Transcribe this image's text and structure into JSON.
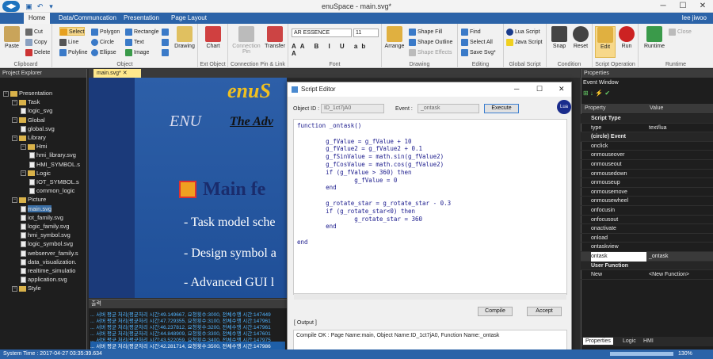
{
  "app": {
    "title": "enuSpace - main.svg*",
    "user": "lee jiwoo"
  },
  "menu_tabs": [
    "Home",
    "Data/Communcation",
    "Presentation",
    "Page Layout"
  ],
  "ribbon": {
    "clipboard": {
      "label": "Clipboard",
      "paste": "Paste",
      "cut": "Cut",
      "copy": "Copy",
      "delete": "Delete"
    },
    "object": {
      "label": "Object",
      "select": "Select",
      "line": "Line",
      "polyline": "Polyline",
      "polygon": "Polygon",
      "circle": "Circle",
      "ellipse": "Ellipse",
      "rectangle": "Rectangle",
      "text": "Text",
      "image": "Image",
      "drawing": "Drawing"
    },
    "ext_object": {
      "label": "Ext Object",
      "chart": "Chart"
    },
    "connection": {
      "label": "Connection Pin & Link",
      "pin": "Connection Pin",
      "transfer": "Transfer"
    },
    "font": {
      "label": "Font",
      "family": "AR ESSENCE",
      "size": "11"
    },
    "drawing": {
      "label": "Drawing",
      "arrange": "Arrange",
      "shape_fill": "Shape Fill",
      "shape_outline": "Shape Outline",
      "shape_effects": "Shape Effects"
    },
    "editing": {
      "label": "Editing",
      "find": "Find",
      "select_all": "Select All",
      "save_svg": "Save Svg*"
    },
    "global_script": {
      "label": "Global Script",
      "lua": "Lua Script",
      "java": "Java Script"
    },
    "condition": {
      "label": "Condition",
      "snap": "Snap",
      "reset": "Reset"
    },
    "script_op": {
      "label": "Script Operation",
      "edit": "Edit",
      "run": "Run"
    },
    "runtime": {
      "label": "Runtime",
      "runtime": "Runtime",
      "close": "Close"
    }
  },
  "project_explorer": {
    "title": "Project Explorer",
    "tree": [
      {
        "label": "Presentation",
        "level": 0,
        "type": "root"
      },
      {
        "label": "Task",
        "level": 1,
        "type": "folder"
      },
      {
        "label": "logic_svg",
        "level": 2,
        "type": "file"
      },
      {
        "label": "Global",
        "level": 1,
        "type": "folder"
      },
      {
        "label": "global.svg",
        "level": 2,
        "type": "file"
      },
      {
        "label": "Library",
        "level": 1,
        "type": "folder"
      },
      {
        "label": "Hmi",
        "level": 2,
        "type": "folder"
      },
      {
        "label": "hmi_library.svg",
        "level": 3,
        "type": "file"
      },
      {
        "label": "HMI_SYMBOL.s",
        "level": 3,
        "type": "file"
      },
      {
        "label": "Logic",
        "level": 2,
        "type": "folder"
      },
      {
        "label": "IOT_SYMBOL.s",
        "level": 3,
        "type": "file"
      },
      {
        "label": "common_logic",
        "level": 3,
        "type": "file"
      },
      {
        "label": "Picture",
        "level": 1,
        "type": "folder"
      },
      {
        "label": "main.svg",
        "level": 2,
        "type": "file",
        "selected": true
      },
      {
        "label": "iot_family.svg",
        "level": 2,
        "type": "file"
      },
      {
        "label": "logic_family.svg",
        "level": 2,
        "type": "file"
      },
      {
        "label": "hmi_symbol.svg",
        "level": 2,
        "type": "file"
      },
      {
        "label": "logic_symbol.svg",
        "level": 2,
        "type": "file"
      },
      {
        "label": "webserver_family.s",
        "level": 2,
        "type": "file"
      },
      {
        "label": "data_visualization.",
        "level": 2,
        "type": "file"
      },
      {
        "label": "realtime_simulatio",
        "level": 2,
        "type": "file"
      },
      {
        "label": "application.svg",
        "level": 2,
        "type": "file"
      },
      {
        "label": "Style",
        "level": 1,
        "type": "folder"
      }
    ]
  },
  "document": {
    "tab": "main.svg*",
    "logo": "enuS",
    "line1": "ENU",
    "line1b": "The Adv",
    "heading": "Main fe",
    "bullets": [
      "- Task model sche",
      "- Design symbol a",
      "- Advanced GUI l"
    ]
  },
  "output": {
    "title": "출력",
    "lines": [
      "... 서버 평균 처리(평균처리 시간:49.149667, 요청횟수:3000, 전체수행 시간:147449",
      "... 서버 평균 처리(평균처리 시간:47.729355, 요청횟수:3100, 전체수행 시간:147961",
      "... 서버 평균 처리(평균처리 시간:46.237812, 요청횟수:3200, 전체수행 시간:147961",
      "... 서버 평균 처리(평균처리 시간:44.848909, 요청횟수:3300, 전체수행 시간:147601",
      "... 서버 평균 처리(평균처리 시간:43.522059, 요청횟수:3400, 전체수행 시간:147975",
      "... 서버 평균 처리(평균처리 시간:42.281714, 요청횟수:3500, 전체수행 시간:147986"
    ]
  },
  "script_editor": {
    "title": "Script Editor",
    "object_id_label": "Object ID :",
    "object_id": "ID_1ct7jA0",
    "event_label": "Event :",
    "event": "_ontask",
    "execute": "Execute",
    "code": [
      "function _ontask()",
      "",
      "        g_fValue = g_fValue + 10",
      "        g_fValue2 = g_fValue2 + 0.1",
      "        g_fSinValue = math.sin(g_fValue2)",
      "        g_fCosValue = math.cos(g_fValue2)",
      "        if (g_fValue > 360) then",
      "                g_fValue = 0",
      "        end",
      "",
      "        g_rotate_star = g_rotate_star - 0.3",
      "        if (g_rotate_star<0) then",
      "                g_rotate_star = 360",
      "        end",
      "",
      "end"
    ],
    "compile": "Compile",
    "accept": "Accept",
    "output_label": "[ Output ]",
    "output_text": "Compile OK : Page Name:main, Object Name:ID_1ct7jA0, Function Name:_ontask"
  },
  "properties": {
    "title": "Properties",
    "window": "Event Window",
    "col_property": "Property",
    "col_value": "Value",
    "rows": [
      {
        "k": "Script Type",
        "v": "",
        "cat": true
      },
      {
        "k": "type",
        "v": "text/lua"
      },
      {
        "k": "(circle) Event",
        "v": "",
        "cat": true
      },
      {
        "k": "onclick",
        "v": ""
      },
      {
        "k": "onmouseover",
        "v": ""
      },
      {
        "k": "onmouseout",
        "v": ""
      },
      {
        "k": "onmousedown",
        "v": ""
      },
      {
        "k": "onmouseup",
        "v": ""
      },
      {
        "k": "onmousemove",
        "v": ""
      },
      {
        "k": "onmousewheel",
        "v": ""
      },
      {
        "k": "onfocusin",
        "v": ""
      },
      {
        "k": "onfocusout",
        "v": ""
      },
      {
        "k": "onactivate",
        "v": ""
      },
      {
        "k": "onload",
        "v": ""
      },
      {
        "k": "ontaskview",
        "v": ""
      },
      {
        "k": "ontask",
        "v": "_ontask",
        "selected": true
      },
      {
        "k": "User Function",
        "v": "",
        "cat": true
      },
      {
        "k": "New",
        "v": "<New Function>"
      }
    ],
    "tabs": [
      "Properties",
      "Logic",
      "HMI"
    ]
  },
  "status": {
    "time": "System Time : 2017-04-27 03:35:39.634",
    "zoom": "130%"
  }
}
